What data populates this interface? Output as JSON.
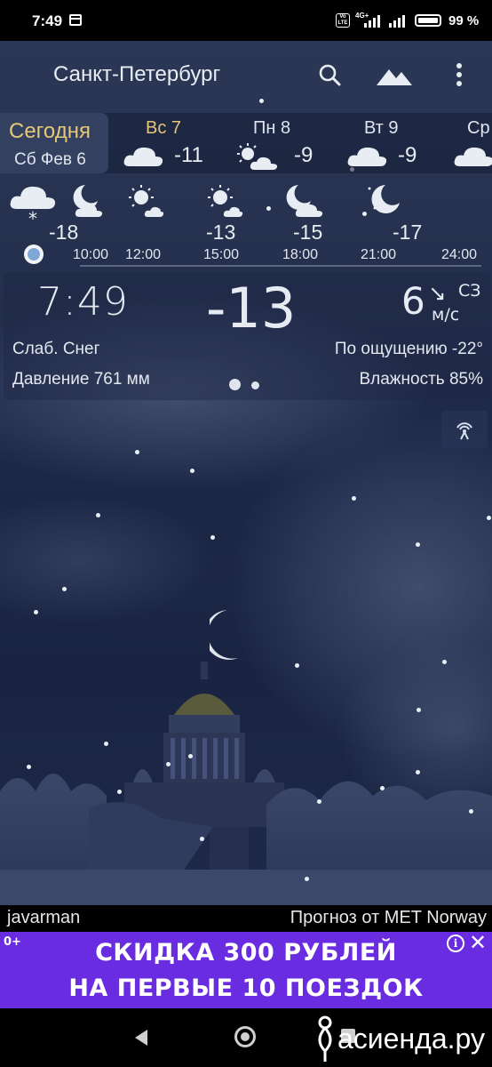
{
  "status_bar": {
    "time": "7:49",
    "network": "4G+",
    "volte": "Vo LTE",
    "battery": "99 %"
  },
  "header": {
    "city": "Санкт-Петербург",
    "icons": [
      "search-icon",
      "landscape-icon",
      "more-vert-icon"
    ]
  },
  "days": [
    {
      "label": "Сегодня",
      "date": "Сб Фев 6",
      "selected": true
    },
    {
      "label": "Вс 7",
      "temp": "-11",
      "icon": "cloud-icon"
    },
    {
      "label": "Пн 8",
      "temp": "-9",
      "icon": "sun-cloud-icon"
    },
    {
      "label": "Вт 9",
      "temp": "-9",
      "icon": "cloud-icon"
    },
    {
      "label": "Ср",
      "icon": "cloud-icon"
    }
  ],
  "hourly": {
    "temps": [
      "-18",
      "-13",
      "-15",
      "-17"
    ],
    "times": [
      "10:00",
      "12:00",
      "15:00",
      "18:00",
      "21:00",
      "24:00"
    ]
  },
  "current": {
    "time": "7:49",
    "temp": "-13",
    "wind_speed": "6",
    "wind_dir": "СЗ",
    "wind_unit": "м/с",
    "condition": "Слаб. Снег",
    "feels_like": "По ощущению -22°",
    "pressure": "Давление 761 мм",
    "humidity": "Влажность 85%"
  },
  "credits": {
    "author": "javarman",
    "provider": "Прогноз от MET Norway"
  },
  "ad": {
    "age": "0+",
    "line1": "СКИДКА 300 РУБЛЕЙ",
    "line2": "НА ПЕРВЫЕ 10 ПОЕЗДОК",
    "info_glyph": "i",
    "close_glyph": "✕"
  },
  "watermark": "асиенда.ру",
  "colors": {
    "today_accent": "#e6c77a",
    "ad_bg": "#6a2ce0",
    "now_dot": "#7ea7d6"
  }
}
